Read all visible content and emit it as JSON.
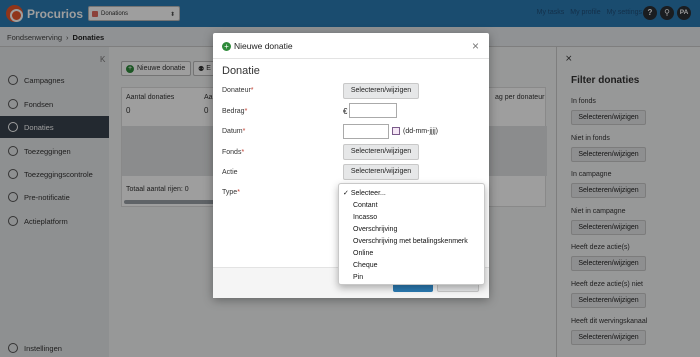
{
  "app": {
    "brand": "Procurios",
    "module": "Donations",
    "links": [
      "My tasks",
      "My profile",
      "My settings"
    ],
    "help_label": "?",
    "search_label": "⚲",
    "avatar_initials": "PA"
  },
  "breadcrumb": {
    "parent": "Fondsenwerving",
    "separator": "›",
    "current": "Donaties"
  },
  "sidebar": {
    "collapse_glyph": "K",
    "items": [
      {
        "label": "Campagnes",
        "icon": "gear-icon"
      },
      {
        "label": "Fondsen",
        "icon": "cloud-icon"
      },
      {
        "label": "Donaties",
        "icon": "user-circle-icon"
      },
      {
        "label": "Toezeggingen",
        "icon": "handshake-icon"
      },
      {
        "label": "Toezeggingscontrole",
        "icon": "check-icon"
      },
      {
        "label": "Pre-notificatie",
        "icon": "bell-icon"
      },
      {
        "label": "Actieplatform",
        "icon": "rocket-icon"
      }
    ],
    "settings": "Instellingen"
  },
  "main": {
    "new_donation_label": "Nieuwe donatie",
    "second_button_partial": "E",
    "columns": [
      {
        "header": "Aantal donaties",
        "value": "0"
      },
      {
        "header": "Aa",
        "value": "0"
      }
    ],
    "right_column_header": "ag per donateur",
    "total_rows": "Totaal aantal rijen: 0"
  },
  "filter": {
    "close_glyph": "⨯",
    "title": "Filter donaties",
    "button_label": "Selecteren/wijzigen",
    "groups": [
      "In fonds",
      "Niet in fonds",
      "In campagne",
      "Niet in campagne",
      "Heeft deze actie(s)",
      "Heeft deze actie(s) niet",
      "Heeft dit wervingskanaal"
    ]
  },
  "modal": {
    "header": "Nieuwe donatie",
    "close": "×",
    "subtitle": "Donatie",
    "select_label": "Selecteren/wijzigen",
    "fields": {
      "donateur": "Donateur",
      "bedrag": "Bedrag",
      "datum": "Datum",
      "fonds": "Fonds",
      "actie": "Actie",
      "type": "Type"
    },
    "required_mark": "*",
    "currency": "€",
    "date_hint": "(dd-mm-jjjj)"
  },
  "type_dropdown": {
    "selected": "Selecteer...",
    "check": "✓",
    "options": [
      "Contant",
      "Incasso",
      "Overschrijving",
      "Overschrijving met betalingskenmerk",
      "Online",
      "Cheque",
      "Pin"
    ]
  },
  "colors": {
    "topbar": "#2b7bb3",
    "sidebar_active": "#39434e",
    "brand_accent": "#e8562a",
    "primary_button": "#2b7bb3"
  }
}
